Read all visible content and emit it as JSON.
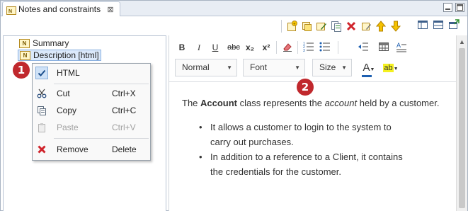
{
  "tab": {
    "title": "Notes and constraints",
    "close_glyph": "⊠"
  },
  "toolbar": {
    "icons": [
      "new-note-icon",
      "add-note-icon",
      "edit-note-icon",
      "copy-note-icon",
      "delete-icon",
      "rename-icon",
      "move-up-icon",
      "move-down-icon"
    ],
    "layout_icons": [
      "layout-horizontal-icon",
      "layout-vertical-icon",
      "layout-export-icon"
    ]
  },
  "tree": {
    "items": [
      {
        "label": "Summary",
        "icon": "N"
      },
      {
        "label": "Description [html]",
        "icon": "N"
      }
    ]
  },
  "menu": {
    "items": [
      {
        "label": "HTML",
        "shortcut": "",
        "icon": "check-icon",
        "checked": true,
        "enabled": true
      },
      {
        "label": "Cut",
        "shortcut": "Ctrl+X",
        "icon": "scissors-icon",
        "enabled": true
      },
      {
        "label": "Copy",
        "shortcut": "Ctrl+C",
        "icon": "copy-icon",
        "enabled": true
      },
      {
        "label": "Paste",
        "shortcut": "Ctrl+V",
        "icon": "paste-icon",
        "enabled": false
      },
      {
        "label": "Remove",
        "shortcut": "Delete",
        "icon": "remove-x-icon",
        "enabled": true
      }
    ]
  },
  "badges": [
    "1",
    "2"
  ],
  "editor": {
    "format_buttons": [
      "B",
      "I",
      "U",
      "abc",
      "x₂",
      "x²"
    ],
    "dropdowns": {
      "style": "Normal",
      "font": "Font",
      "size": "Size"
    },
    "text_color_glyph": "A",
    "highlight_glyph": "ab",
    "content": {
      "para_prefix": "The ",
      "para_bold": "Account",
      "para_mid": " class represents the ",
      "para_italic": "account",
      "para_suffix": " held by a customer.",
      "bullets": [
        [
          "It allows a customer to login to the system to",
          "carry out purchases."
        ],
        [
          "In addition to a reference to a Client, it contains",
          "the credentials for the customer."
        ]
      ]
    }
  },
  "colors": {
    "badge": "#c0282d",
    "accent": "#1d5fb0"
  }
}
